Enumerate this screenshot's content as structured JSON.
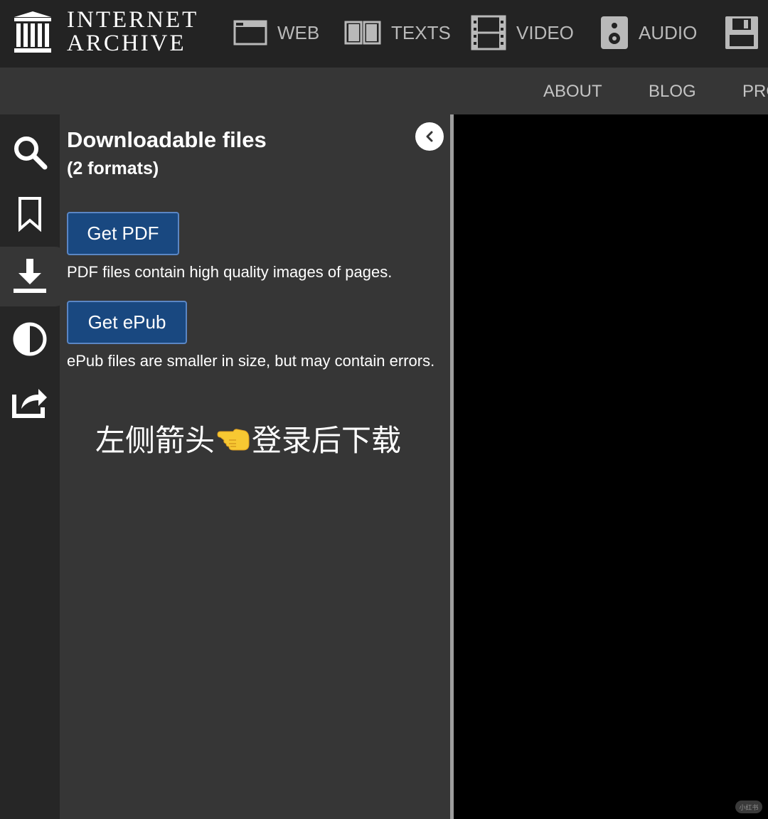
{
  "header": {
    "logo_line1": "INTERNET",
    "logo_line2": "ARCHIVE",
    "media_tabs": [
      {
        "label": "WEB",
        "icon": "web-window-icon"
      },
      {
        "label": "TEXTS",
        "icon": "open-book-icon"
      },
      {
        "label": "VIDEO",
        "icon": "film-strip-icon"
      },
      {
        "label": "AUDIO",
        "icon": "speaker-icon"
      },
      {
        "label": "",
        "icon": "floppy-disk-icon"
      }
    ]
  },
  "subnav": {
    "items": [
      "ABOUT",
      "BLOG",
      "PRO"
    ]
  },
  "rail": {
    "icons": [
      "search-icon",
      "bookmark-icon",
      "download-icon",
      "contrast-icon",
      "share-icon"
    ],
    "active": "download-icon"
  },
  "panel": {
    "title": "Downloadable files",
    "subtitle": "(2 formats)",
    "pdf": {
      "button": "Get PDF",
      "description": "PDF files contain high quality images of pages."
    },
    "epub": {
      "button": "Get ePub",
      "description": "ePub files are smaller in size, but may contain errors."
    },
    "note_before": "左侧箭头",
    "note_emoji": "hand-pointing-left",
    "note_after": "登录后下载"
  },
  "colors": {
    "topbar": "#232323",
    "panel": "#363636",
    "rail": "#262626",
    "button": "#194880",
    "button_border": "#5a86c4"
  },
  "watermark": "小红书"
}
